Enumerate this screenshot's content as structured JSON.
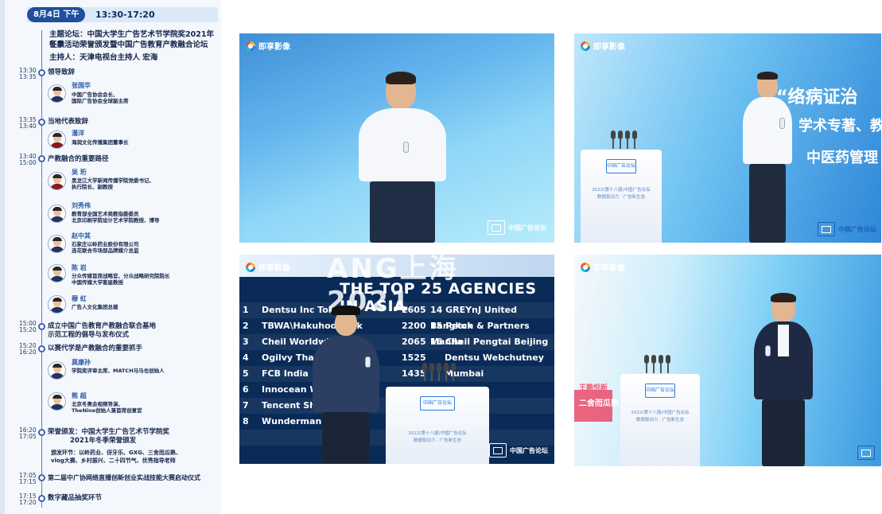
{
  "schedule": {
    "date_label": "8月4日 下午",
    "time_range": "13:30-17:20",
    "forum_title_1": "主题论坛：中国大学生广告艺术节学院奖2021年冬季",
    "forum_title_2": "征集活动荣誉颁发暨中国广告教育产教融合论坛",
    "host": "主持人：天津电视台主持人 宏海",
    "sections": [
      {
        "time": [
          "13:30",
          "13:35"
        ],
        "title": "领导致辞"
      },
      {
        "time": [
          "13:35",
          "13:40"
        ],
        "title": "当地代表致辞"
      },
      {
        "time": [
          "13:40",
          "15:00"
        ],
        "title": "产教融合的重要路径"
      },
      {
        "time": [
          "15:00",
          "15:20"
        ],
        "title": "成立中国广告教育产教融合联合基地",
        "title2": "示范工程的倡导与发布仪式"
      },
      {
        "time": [
          "15:20",
          "16:20"
        ],
        "title": "以赛代学是产教融合的重要抓手"
      },
      {
        "time": [
          "16:20",
          "17:05"
        ],
        "title": "荣誉颁发：中国大学生广告艺术节学院奖",
        "title2": "2021年冬季荣誉颁发",
        "sub1": "颁发环节：以岭药业、伢牙乐、GXG、三舍而瓜熟、",
        "sub2": "vlog大赛、乡村振兴、二十四节气、优秀指导老师"
      },
      {
        "time": [
          "17:05",
          "17:15"
        ],
        "title": "第二届中广协网络直播创新创业实战技能大赛启动仪式"
      },
      {
        "time": [
          "17:15",
          "17:20"
        ],
        "title": "数字藏品抽奖环节"
      }
    ],
    "speakers": [
      {
        "name": "张国华",
        "title1": "中国广告协会会长、",
        "title2": "国际广告协会全球副主席"
      },
      {
        "name": "潘洋",
        "title1": "海润文化传播集团董事长",
        "title2": ""
      },
      {
        "name": "吴 珩",
        "title1": "黑龙江大学新闻传播学院党委书记、",
        "title2": "执行院长、副教授"
      },
      {
        "name": "刘秀伟",
        "title1": "教育部全国艺术类教指委委员",
        "title2": "北京印刷学院设计艺术学院教授、博导"
      },
      {
        "name": "赵中其",
        "title1": "石家庄以岭药业股份有限公司",
        "title2": "连花联合市场部品牌媒介总监"
      },
      {
        "name": "陈 岩",
        "title1": "分众传媒首席战略官、分众战略研究院院长",
        "title2": "中国传媒大学客座教授"
      },
      {
        "name": "穆 虹",
        "title1": "广告人文化集团总裁",
        "title2": ""
      },
      {
        "name": "莫康孙",
        "title1": "学院奖评审主席、MATCH马马也创始人",
        "title2": ""
      },
      {
        "name": "熊 超",
        "title1": "北京冬奥会视频导演、",
        "title2": "TheNine创始人兼首席创意官"
      }
    ]
  },
  "photos": {
    "brand": "即享影像",
    "watermark": "中国广告论坛",
    "photo2_text_1": "立“络病证治",
    "photo2_text_2": "学术专著、教",
    "photo2_text_3": "中医药管理",
    "podium_badge": "中国广告论坛",
    "podium_line1": "2022(第十八届)中国广告论坛",
    "podium_line2": "数据驱动力 · 广告新生态",
    "photo3_band": "ANG上海 2021",
    "photo3_title": "THE TOP 25 AGENCIES IN ASIA",
    "photo4_screen": "二舍而瓜熟",
    "photo4_screen2": "王鹏悦新"
  },
  "top25": {
    "left": [
      {
        "n": "1",
        "name": "Dentsu Inc Tokyo",
        "v": "2605"
      },
      {
        "n": "2",
        "name": "TBWA\\Hakuhodo Tok",
        "v": "2200"
      },
      {
        "n": "3",
        "name": "Cheil Worldwi",
        "v": "2065"
      },
      {
        "n": "4",
        "name": "Ogilvy Thaila",
        "v": "1525"
      },
      {
        "n": "5",
        "name": "FCB India",
        "v": "1435"
      },
      {
        "n": "6",
        "name": "Innocean We",
        "v": ""
      },
      {
        "n": "7",
        "name": "Tencent She",
        "v": ""
      },
      {
        "n": "8",
        "name": "Wunderman",
        "v": ""
      }
    ],
    "right": [
      {
        "n": "14",
        "name": "GREYnJ United Bangkok"
      },
      {
        "n": "15",
        "name": "Petch & Partners Manila"
      },
      {
        "n": "16",
        "name": "Cheil Pengtai Beijing"
      },
      {
        "n": "",
        "name": "Dentsu Webchutney Mumbai"
      }
    ]
  }
}
